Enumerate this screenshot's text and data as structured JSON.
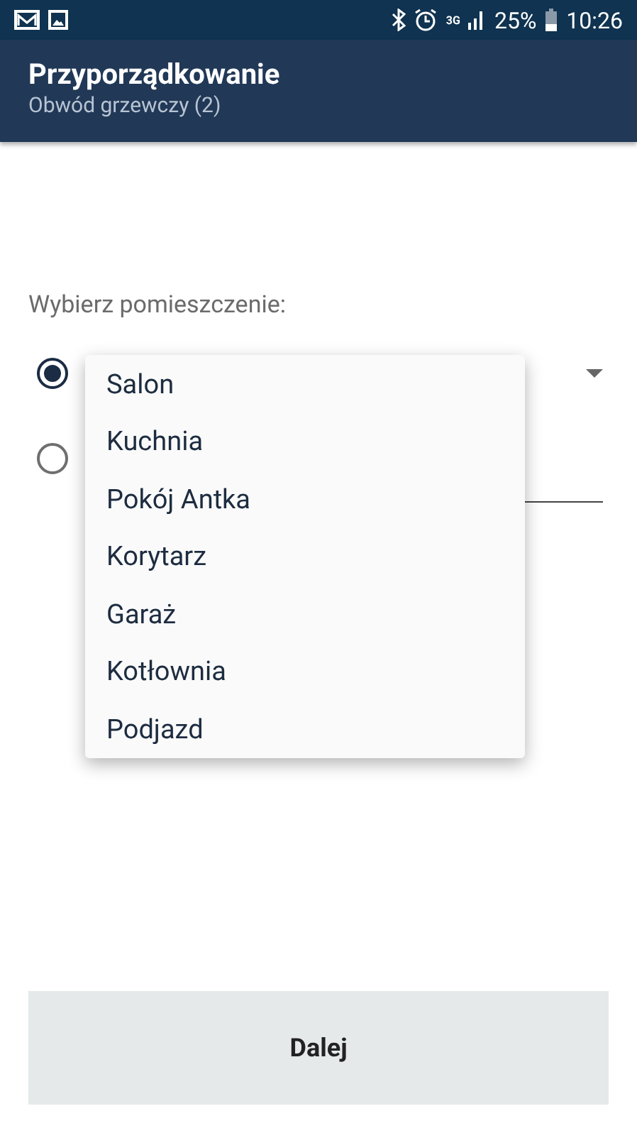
{
  "status_bar": {
    "network": "3G",
    "battery": "25%",
    "time": "10:26"
  },
  "app_bar": {
    "title": "Przyporządkowanie",
    "subtitle": "Obwód grzewczy (2)"
  },
  "prompt": "Wybierz pomieszczenie:",
  "options": [
    {
      "kind": "dropdown",
      "selected": true
    },
    {
      "kind": "text_field",
      "selected": false
    }
  ],
  "dropdown_menu": [
    "Salon",
    "Kuchnia",
    "Pokój Antka",
    "Korytarz",
    "Garaż",
    "Kotłownia",
    "Podjazd"
  ],
  "button": "Dalej"
}
